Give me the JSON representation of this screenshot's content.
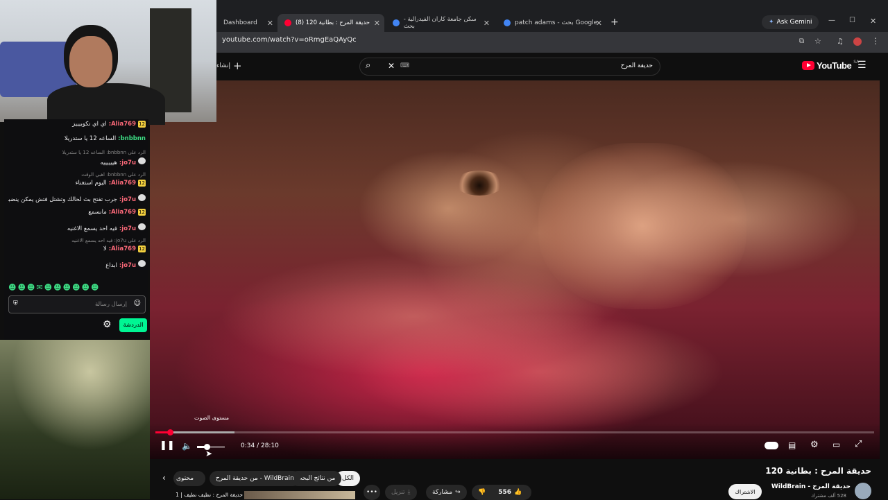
{
  "browser": {
    "tabs": [
      {
        "label": "Dashboard"
      },
      {
        "label": "(8) حديقة المرح : بطانية 120"
      },
      {
        "label": "سكن جامعة كاران الفيدرالية - بحث"
      },
      {
        "label": "patch adams - بحث Google"
      }
    ],
    "ask_gemini": "Ask Gemini",
    "url": "youtube.com/watch?v=oRmgEaQAyQc"
  },
  "youtube": {
    "logo": "YouTube",
    "region": "SA",
    "search_value": "حديقة المرح",
    "create_label": "إنشاء",
    "player": {
      "progress": 0.02,
      "buffered": 0.11,
      "time": "0:34 / 28:10",
      "volume_tooltip": "مستوى الصوت",
      "volume": 0.35
    },
    "video_title": "حديقة المرح : بطانية 120",
    "channel_name": "WildBrain - حديقة المرح",
    "subscribers": "528 ألف مشترك",
    "subscribe_label": "الاشتراك",
    "likes": "556",
    "share_label": "مشاركة",
    "download_label": "تنزيل",
    "chips": [
      "الكل",
      "من نتائج البحث",
      "من حديقة المرح - WildBrain",
      "محتوى"
    ],
    "next_video": "حديقة المرح : نظيف نظيف | 1"
  },
  "chat": {
    "messages": [
      {
        "user": "Alia769",
        "text": "اي اي تكوبيييز",
        "badge": "12",
        "color": "#ff6a7a"
      },
      {
        "user": "bnbbnn",
        "text": "الساعه 12 يا ستدريلا",
        "badge": "",
        "color": "#3ddc84"
      },
      {
        "user": "jo7u",
        "text": "هييييييه",
        "badge": "●",
        "color": "#ff6a7a",
        "reply": "الرد على bnbbnn: الساعه 12 يا ستدريلا"
      },
      {
        "user": "Alia769",
        "text": "اليوم استغناء",
        "badge": "12",
        "color": "#ff6a7a",
        "reply": "الرد على bnbbnn: اهبي الوقت"
      },
      {
        "user": "jo7u",
        "text": "جرب تفتح بث لحالك وتشتل فتش يمكن ينضبط",
        "badge": "●",
        "color": "#ff6a7a"
      },
      {
        "user": "Alia769",
        "text": "مانسمع",
        "badge": "12",
        "color": "#ff6a7a"
      },
      {
        "user": "jo7u",
        "text": "فيه احد يسمع الاغنيه",
        "badge": "●",
        "color": "#ff6a7a"
      },
      {
        "user": "Alia769",
        "text": "لا",
        "badge": "12",
        "color": "#ff6a7a",
        "reply": "الرد على jo7u: فيه احد يسمع الاغنيه"
      },
      {
        "user": "jo7u",
        "text": "ابداع",
        "badge": "●",
        "color": "#ff6a7a"
      }
    ],
    "input_placeholder": "إرسال رسالة",
    "chat_button": "الدردشة"
  },
  "colors": {
    "accent": "#ff0033",
    "twitch_green": "#00f593",
    "progress_gray": "#aaaaaa"
  }
}
